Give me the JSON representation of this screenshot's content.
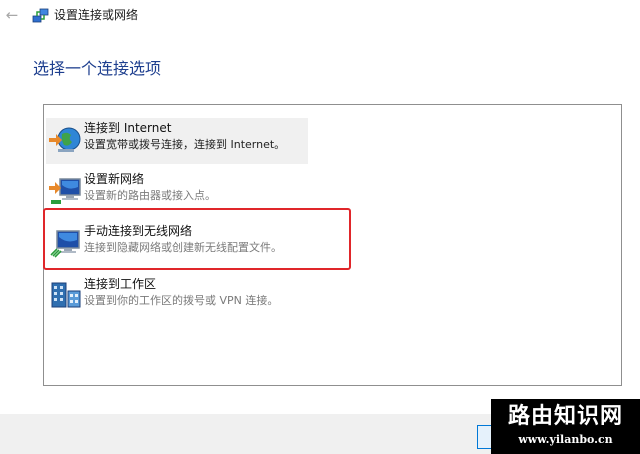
{
  "window": {
    "title": "设置连接或网络",
    "back_glyph": "←",
    "icon": "network-setup-icon"
  },
  "heading": "选择一个连接选项",
  "options": [
    {
      "title": "连接到 Internet",
      "description": "设置宽带或拨号连接，连接到 Internet。",
      "icon": "globe-internet-icon",
      "selected": true
    },
    {
      "title": "设置新网络",
      "description": "设置新的路由器或接入点。",
      "icon": "new-network-icon",
      "selected": false
    },
    {
      "title": "手动连接到无线网络",
      "description": "连接到隐藏网络或创建新无线配置文件。",
      "icon": "wireless-network-icon",
      "selected": false
    },
    {
      "title": "连接到工作区",
      "description": "设置到你的工作区的拨号或 VPN 连接。",
      "icon": "workplace-icon",
      "selected": false
    }
  ],
  "watermark": {
    "title": "路由知识网",
    "url": "www.yilanbo.cn"
  },
  "colors": {
    "heading": "#1e3f8f",
    "highlight": "#e0262a",
    "selected_bg": "#f0f0f0",
    "accent": "#0078d7"
  }
}
